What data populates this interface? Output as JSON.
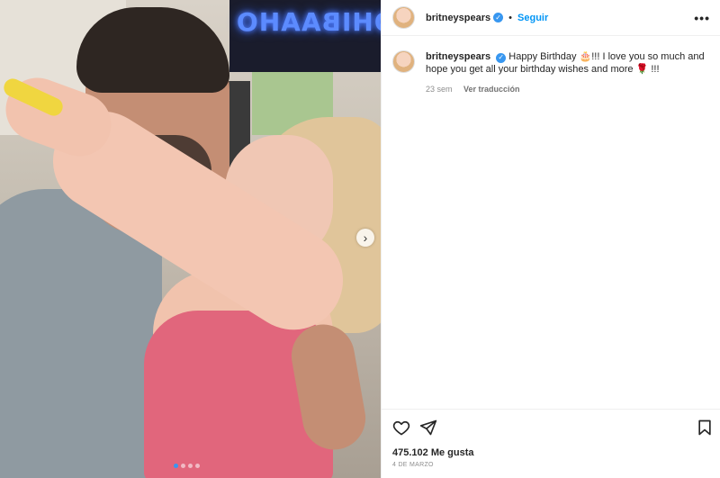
{
  "media": {
    "sign_text": "OHIBAAHO",
    "carousel": {
      "count": 4,
      "active_index": 0
    }
  },
  "header": {
    "username": "britneyspears",
    "verified_mark": "✓",
    "separator": "•",
    "follow_label": "Seguir",
    "more_label": "•••"
  },
  "caption": {
    "username": "britneyspears",
    "verified_mark": "✓",
    "text_part1": "Happy Birthday ",
    "emoji_cake": "🎂",
    "text_part2": "!!! I love you so much and hope you get all your birthday wishes and more ",
    "emoji_rose": "🌹",
    "text_part3": " !!!",
    "time": "23 sem",
    "translate_label": "Ver traducción"
  },
  "actions": {
    "like_icon": "heart-icon",
    "share_icon": "paper-plane-icon",
    "save_icon": "bookmark-icon"
  },
  "likes_text": "475.102 Me gusta",
  "date_text": "4 DE MARZO",
  "colors": {
    "accent": "#0095f6",
    "verified": "#3897f0",
    "text": "#262626",
    "muted": "#8e8e8e"
  }
}
